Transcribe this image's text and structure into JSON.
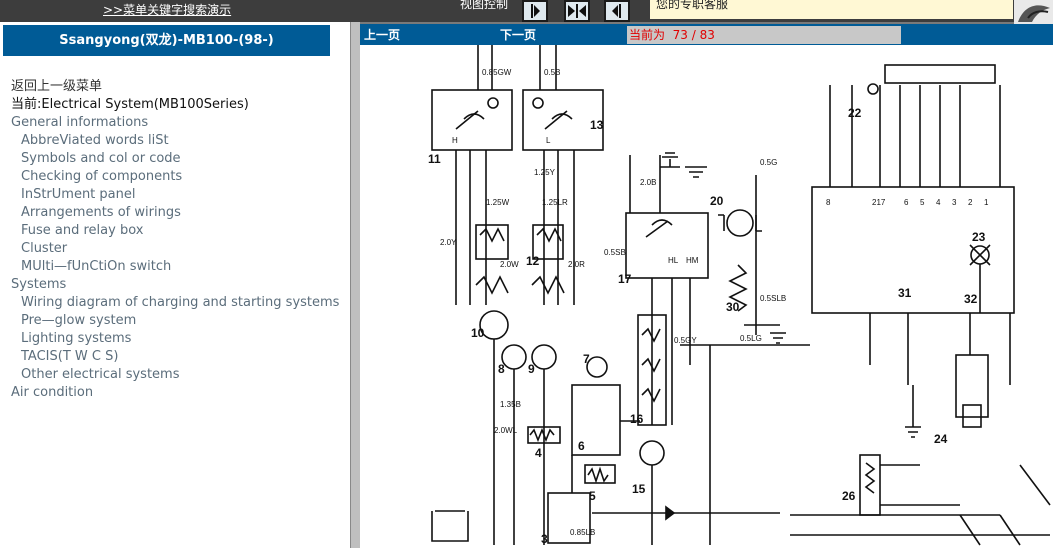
{
  "topbar": {
    "search_link": ">>菜单关键字搜索演示",
    "view_control": "视图控制",
    "service": "您的专职客服",
    "buttons": [
      {
        "icon": "arrow-right-icon"
      },
      {
        "icon": "arrows-collapse-icon"
      },
      {
        "icon": "arrow-left-icon"
      }
    ]
  },
  "sidebar": {
    "header": "Ssangyong(双龙)-MB100-(98-)",
    "back": "返回上一级菜单",
    "current": "当前:Electrical System(MB100Series)",
    "items": [
      {
        "label": "General informations",
        "level": 0
      },
      {
        "label": "AbbreViated words liSt",
        "level": 1
      },
      {
        "label": "Symbols and col or code",
        "level": 1
      },
      {
        "label": "Checking of components",
        "level": 1
      },
      {
        "label": "InStrUment panel",
        "level": 1
      },
      {
        "label": "Arrangements of wirings",
        "level": 1
      },
      {
        "label": "Fuse and relay box",
        "level": 1
      },
      {
        "label": "Cluster",
        "level": 1
      },
      {
        "label": "MUlti—fUnCtiOn switch",
        "level": 1
      },
      {
        "label": "Systems",
        "level": 0
      },
      {
        "label": "Wiring diagram of charging and starting systems",
        "level": 1
      },
      {
        "label": "Pre—glow system",
        "level": 1
      },
      {
        "label": "Lighting systems",
        "level": 1
      },
      {
        "label": "TACIS(T W C S)",
        "level": 1
      },
      {
        "label": "Other electrical systems",
        "level": 1
      },
      {
        "label": "Air condition",
        "level": 0
      }
    ]
  },
  "pager": {
    "prev": "上一页",
    "next": "下一页",
    "current_label": "当前为",
    "page": "73 / 83"
  },
  "diagram_labels": {
    "n11": "11",
    "n13": "13",
    "n12": "12",
    "n10": "10",
    "n8": "8",
    "n9": "9",
    "n7": "7",
    "n6": "6",
    "n4": "4",
    "n5": "5",
    "n3": "3",
    "n15": "15",
    "n16": "16",
    "n17": "17",
    "n20": "20",
    "n30": "30",
    "n22": "22",
    "n23": "23",
    "n31": "31",
    "n32": "32",
    "n24": "24",
    "n26": "26",
    "w_2DY": "2.0Y",
    "w_125W": "1.25W",
    "w_2DW": "2.0W",
    "w_125LR": "1.25LR",
    "w_2DR": "2.0R",
    "w_085GW": "0.85GW",
    "w_05B": "0.5B",
    "w_2DB": "2.0B",
    "w_05SB": "0.5SB",
    "w_085LB": "0.85LB",
    "w_05G": "0.5G",
    "w_05SLB": "0.5SLB",
    "w_135B": "1.35B",
    "w_2DWL": "2.0WL",
    "w_05GY": "0.5GY",
    "w_125Y": "1.25Y",
    "w_05LG": "0.5LG",
    "t_H": "H",
    "t_L": "L",
    "t_HL": "HL",
    "t_HM": "HM",
    "t_8": "8",
    "t_217": "217",
    "t_6": "6",
    "t_5": "5",
    "t_4": "4",
    "t_3": "3",
    "t_2": "2",
    "t_1": "1"
  }
}
